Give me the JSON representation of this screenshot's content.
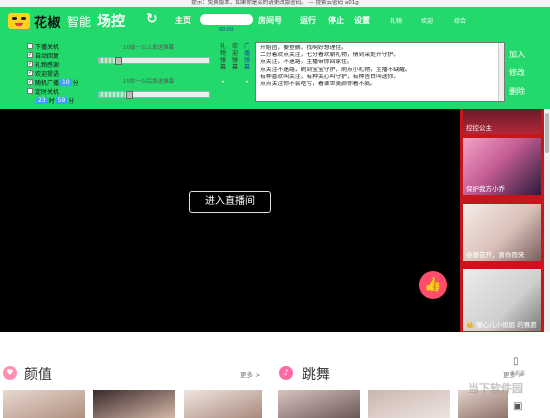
{
  "notice": "提示：免费版本，如果你是买的请更改版密码。 — 提索云密码 a01g",
  "titlebar": {
    "brand_part1": "花椒",
    "brand_part2": "智能",
    "brand_part3": "场控",
    "refresh_icon": "refresh-icon",
    "nav_home": "主页",
    "nav_room_no": "房间号",
    "nav_run": "运行",
    "nav_stop": "停止",
    "nav_settings": "设置",
    "nav_gift": "礼物",
    "nav_welcome": "欢迎",
    "nav_misc": "综合",
    "timer": "00:00",
    "room_input_value": ""
  },
  "panel": {
    "options": [
      {
        "label": "下播关机",
        "checked": false
      },
      {
        "label": "自动回复",
        "checked": true
      },
      {
        "label": "礼物感谢",
        "checked": true
      },
      {
        "label": "欢迎提语",
        "checked": true
      },
      {
        "label": "随机广播",
        "checked": true
      },
      {
        "label": "定时关机",
        "checked": false
      }
    ],
    "broadcast_value": "10",
    "broadcast_unit": "分",
    "shutdown_hour": "23",
    "shutdown_sep": "时",
    "shutdown_min": "59",
    "shutdown_unit": "分",
    "gift_rule_1": "10级一以上发送弹幕",
    "gift_rule_2": "15秒一以后发送弹幕",
    "slider1_level": 0.17,
    "slider2_level": 0.27,
    "vlabel_gift_bullet": "礼物弹幕",
    "vlabel_welcome_bullet": "欢迎弹幕",
    "vlabel_ad_bullet": "广播弹幕",
    "messages": [
      "开始团，要登融，找啊好想理住。",
      "二分着欢点关注，七分看欢朝礼物，倩到采处开守护。",
      "点关注，不迷路，主播带你回家住。",
      "点关注不迷路，刷到宝宝守护，刷点小礼物，主播不缺醒。",
      "有种喜欢叫关注，有种关心叫守护，有种告白叫送你。",
      "点点关注你不会吃亏，看谁世美颜你看不腻。"
    ],
    "btn_add": "加入",
    "btn_edit": "修改",
    "btn_delete": "删除"
  },
  "video": {
    "enter_label": "进入直播间",
    "like_icon": "thumbs-up-icon"
  },
  "thumbs": [
    {
      "caption": "控控公主"
    },
    {
      "caption": "保护我方小乔"
    },
    {
      "caption": "春暖花开，勇你而来"
    },
    {
      "caption": "👑 暖心儿小姐姐 的赛愿"
    }
  ],
  "sections": {
    "left_title": "颜值",
    "left_more": "更多 >",
    "right_title": "跳舞",
    "right_more": "更多 >",
    "tool1_label": "手机看",
    "tool2_label": "开播"
  },
  "watermark": "当下软件园",
  "colors": {
    "accent_green": "#23d96b",
    "thumb_red": "#c4161c",
    "like_pink": "#ff4d6a"
  }
}
